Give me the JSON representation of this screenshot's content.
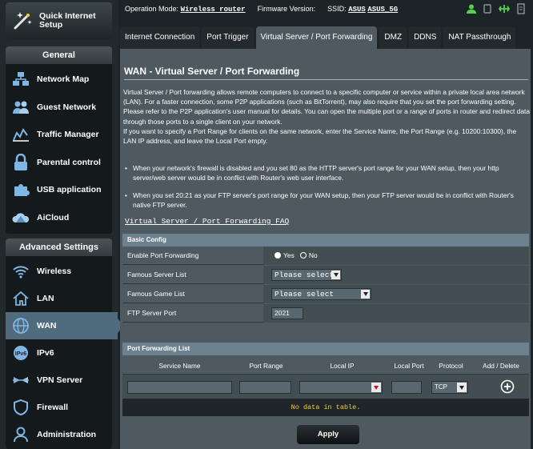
{
  "topbar": {
    "operation_mode_label": "Operation Mode:",
    "operation_mode_value": "Wireless router",
    "firmware_label": "Firmware Version:",
    "ssid_label": "SSID:",
    "ssid_24": "ASUS",
    "ssid_5": "ASUS_5G"
  },
  "sidebar": {
    "qis_label": "Quick Internet Setup",
    "general_title": "General",
    "general_items": [
      {
        "label": "Network Map",
        "icon": "network-map-icon"
      },
      {
        "label": "Guest Network",
        "icon": "guest-network-icon"
      },
      {
        "label": "Traffic Manager",
        "icon": "traffic-manager-icon"
      },
      {
        "label": "Parental control",
        "icon": "lock-icon"
      },
      {
        "label": "USB application",
        "icon": "puzzle-icon"
      },
      {
        "label": "AiCloud",
        "icon": "cloud-icon"
      }
    ],
    "advanced_title": "Advanced Settings",
    "advanced_items": [
      {
        "label": "Wireless",
        "icon": "wifi-icon"
      },
      {
        "label": "LAN",
        "icon": "home-icon"
      },
      {
        "label": "WAN",
        "icon": "globe-icon",
        "active": true
      },
      {
        "label": "IPv6",
        "icon": "ipv6-icon"
      },
      {
        "label": "VPN Server",
        "icon": "vpn-icon"
      },
      {
        "label": "Firewall",
        "icon": "shield-icon"
      },
      {
        "label": "Administration",
        "icon": "user-icon"
      }
    ]
  },
  "tabs": [
    {
      "label": "Internet Connection"
    },
    {
      "label": "Port Trigger"
    },
    {
      "label": "Virtual Server / Port Forwarding",
      "active": true
    },
    {
      "label": "DMZ"
    },
    {
      "label": "DDNS"
    },
    {
      "label": "NAT Passthrough"
    }
  ],
  "main": {
    "title": "WAN - Virtual Server / Port Forwarding",
    "desc_1": "Virtual Server / Port forwarding allows remote computers to connect to a specific computer or service within a private local area network (LAN). For a faster connection, some P2P applications (such as BitTorrent), may also require that you set the port forwarding setting. Please refer to the P2P application's user manual for details. You can open the multiple port or a range of ports in router and redirect data through those ports to a single client on your network.",
    "desc_2": "If you want to specify a Port Range for clients on the same network, enter the Service Name, the Port Range (e.g. 10200:10300), the LAN IP address, and leave the Local Port empty.",
    "bullet_1": "When your network's firewall is disabled and you set 80 as the HTTP server's port range for your WAN setup, then your http server/web server would be in conflict with Router's web user interface.",
    "bullet_2": "When you set 20:21 as your FTP server's port range for your WAN setup, then your FTP server would be in conflict with Router's native FTP server.",
    "faq_link": "Virtual Server / Port Forwarding FAQ"
  },
  "basic_config": {
    "header": "Basic Config",
    "enable_label": "Enable Port Forwarding",
    "yes_label": "Yes",
    "no_label": "No",
    "enabled": true,
    "famous_server_label": "Famous Server List",
    "famous_server_value": "Please select",
    "famous_game_label": "Famous Game List",
    "famous_game_value": "Please select",
    "ftp_port_label": "FTP Server Port",
    "ftp_port_value": "2021"
  },
  "port_forwarding": {
    "header": "Port Forwarding List",
    "columns": [
      "Service Name",
      "Port Range",
      "Local IP",
      "Local Port",
      "Protocol",
      "Add / Delete"
    ],
    "protocol_value": "TCP",
    "empty_text": "No data in table."
  },
  "apply_label": "Apply",
  "colors": {
    "background": "#1d2427",
    "panel": "#4e5a60",
    "table_header": "#6e8190",
    "active_nav": "#4f6b7c",
    "empty_text": "#f7d31e",
    "status_icon_green": "#56d24b"
  }
}
